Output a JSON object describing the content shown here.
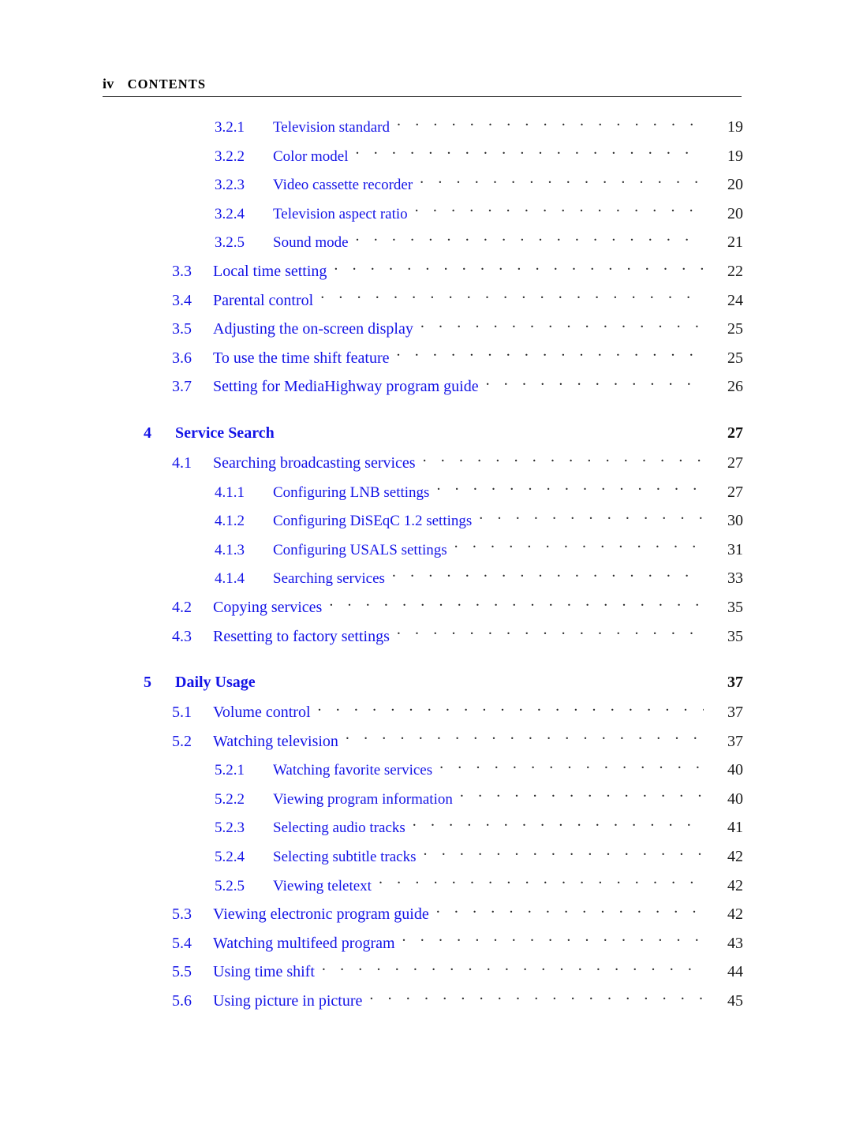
{
  "header": {
    "folio": "iv",
    "title": "CONTENTS"
  },
  "colors": {
    "link_blue": "#1414e6",
    "page_number": "#1d1d1d",
    "leader_dots": "#2a2a2a",
    "rule": "#2b2b2b",
    "background": "#ffffff"
  },
  "toc": {
    "leader_dots": ". . . . . . . . . . . . . . . . . . . . . . . . . . . . . . . . . . . . . . . . . . . . . .",
    "entries": [
      {
        "level": "subsection",
        "number": "3.2.1",
        "title": "Television standard",
        "page": "19"
      },
      {
        "level": "subsection",
        "number": "3.2.2",
        "title": "Color model",
        "page": "19"
      },
      {
        "level": "subsection",
        "number": "3.2.3",
        "title": "Video cassette recorder",
        "page": "20"
      },
      {
        "level": "subsection",
        "number": "3.2.4",
        "title": "Television aspect ratio",
        "page": "20"
      },
      {
        "level": "subsection",
        "number": "3.2.5",
        "title": "Sound mode",
        "page": "21"
      },
      {
        "level": "section",
        "number": "3.3",
        "title": "Local time setting",
        "page": "22"
      },
      {
        "level": "section",
        "number": "3.4",
        "title": "Parental control",
        "page": "24"
      },
      {
        "level": "section",
        "number": "3.5",
        "title": "Adjusting the on-screen display",
        "page": "25"
      },
      {
        "level": "section",
        "number": "3.6",
        "title": "To use the time shift feature",
        "page": "25"
      },
      {
        "level": "section",
        "number": "3.7",
        "title": "Setting for MediaHighway program guide",
        "page": "26"
      },
      {
        "level": "chapter",
        "number": "4",
        "title": "Service Search",
        "page": "27"
      },
      {
        "level": "section",
        "number": "4.1",
        "title": "Searching broadcasting services",
        "page": "27"
      },
      {
        "level": "subsection",
        "number": "4.1.1",
        "title": "Configuring LNB settings",
        "page": "27"
      },
      {
        "level": "subsection",
        "number": "4.1.2",
        "title": "Configuring DiSEqC 1.2 settings",
        "page": "30"
      },
      {
        "level": "subsection",
        "number": "4.1.3",
        "title": "Configuring USALS settings",
        "page": "31"
      },
      {
        "level": "subsection",
        "number": "4.1.4",
        "title": "Searching services",
        "page": "33"
      },
      {
        "level": "section",
        "number": "4.2",
        "title": "Copying services",
        "page": "35"
      },
      {
        "level": "section",
        "number": "4.3",
        "title": "Resetting to factory settings",
        "page": "35"
      },
      {
        "level": "chapter",
        "number": "5",
        "title": "Daily Usage",
        "page": "37"
      },
      {
        "level": "section",
        "number": "5.1",
        "title": "Volume control",
        "page": "37"
      },
      {
        "level": "section",
        "number": "5.2",
        "title": "Watching television",
        "page": "37"
      },
      {
        "level": "subsection",
        "number": "5.2.1",
        "title": "Watching favorite services",
        "page": "40"
      },
      {
        "level": "subsection",
        "number": "5.2.2",
        "title": "Viewing program information",
        "page": "40"
      },
      {
        "level": "subsection",
        "number": "5.2.3",
        "title": "Selecting audio tracks",
        "page": "41"
      },
      {
        "level": "subsection",
        "number": "5.2.4",
        "title": "Selecting subtitle tracks",
        "page": "42"
      },
      {
        "level": "subsection",
        "number": "5.2.5",
        "title": "Viewing teletext",
        "page": "42"
      },
      {
        "level": "section",
        "number": "5.3",
        "title": "Viewing electronic program guide",
        "page": "42"
      },
      {
        "level": "section",
        "number": "5.4",
        "title": "Watching multifeed program",
        "page": "43"
      },
      {
        "level": "section",
        "number": "5.5",
        "title": "Using time shift",
        "page": "44"
      },
      {
        "level": "section",
        "number": "5.6",
        "title": "Using picture in picture",
        "page": "45"
      }
    ]
  }
}
